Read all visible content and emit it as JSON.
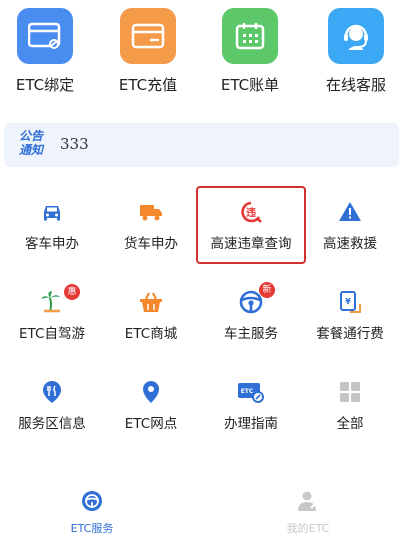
{
  "top_tiles": [
    {
      "label": "ETC绑定",
      "icon": "etc-card-link-icon",
      "color": "#4a8df0"
    },
    {
      "label": "ETC充值",
      "icon": "etc-recharge-card-icon",
      "color": "#f59a47"
    },
    {
      "label": "ETC账单",
      "icon": "etc-bill-calendar-icon",
      "color": "#5cc86a"
    },
    {
      "label": "在线客服",
      "icon": "online-service-headset-icon",
      "color": "#3ba7f5"
    }
  ],
  "notice": {
    "tag_line1": "公告",
    "tag_line2": "通知",
    "text": "333"
  },
  "grid": [
    {
      "label": "客车申办",
      "icon": "car-icon"
    },
    {
      "label": "货车申办",
      "icon": "truck-icon"
    },
    {
      "label": "高速违章查询",
      "icon": "violation-query-icon"
    },
    {
      "label": "高速救援",
      "icon": "warning-triangle-icon"
    },
    {
      "label": "ETC自驾游",
      "icon": "palm-tree-icon",
      "badge": "惠"
    },
    {
      "label": "ETC商城",
      "icon": "shopping-basket-icon"
    },
    {
      "label": "车主服务",
      "icon": "steering-wheel-icon",
      "badge": "新"
    },
    {
      "label": "套餐通行费",
      "icon": "toll-package-icon"
    },
    {
      "label": "服务区信息",
      "icon": "service-area-pin-icon"
    },
    {
      "label": "ETC网点",
      "icon": "location-pin-icon"
    },
    {
      "label": "办理指南",
      "icon": "guide-card-icon"
    },
    {
      "label": "全部",
      "icon": "all-grid-icon"
    }
  ],
  "tabs": [
    {
      "label": "ETC服务",
      "icon": "etc-service-icon",
      "active": true
    },
    {
      "label": "我的ETC",
      "icon": "user-icon",
      "active": false
    }
  ],
  "colors": {
    "accent": "#2f6fd6",
    "inactive": "#c8c8c8",
    "highlight": "#d32f2f",
    "notice_bg": "#eef3fc"
  }
}
